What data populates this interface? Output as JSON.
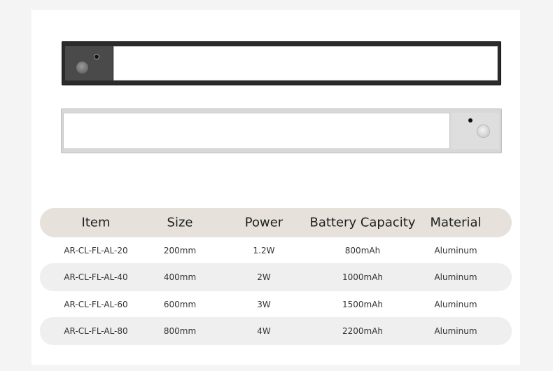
{
  "products": {
    "images": [
      {
        "finish": "black",
        "icon": "light-bar"
      },
      {
        "finish": "silver",
        "icon": "light-bar"
      }
    ]
  },
  "table": {
    "headers": [
      "Item",
      "Size",
      "Power",
      "Battery Capacity",
      "Material"
    ],
    "rows": [
      [
        "AR-CL-FL-AL-20",
        "200mm",
        "1.2W",
        "800mAh",
        "Aluminum"
      ],
      [
        "AR-CL-FL-AL-40",
        "400mm",
        "2W",
        "1000mAh",
        "Aluminum"
      ],
      [
        "AR-CL-FL-AL-60",
        "600mm",
        "3W",
        "1500mAh",
        "Aluminum"
      ],
      [
        "AR-CL-FL-AL-80",
        "800mm",
        "4W",
        "2200mAh",
        "Aluminum"
      ]
    ]
  },
  "colors": {
    "header_bg": "#e6e1da",
    "stripe_bg": "#efefef",
    "dark_bar": "#2b2b2b",
    "silver_bar": "#d8d8d8"
  }
}
